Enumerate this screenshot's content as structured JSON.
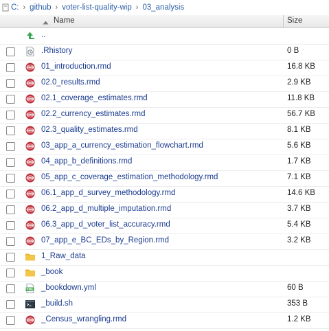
{
  "breadcrumb": {
    "segments": [
      "C:",
      "github",
      "voter-list-quality-wip",
      "03_analysis"
    ],
    "separator": "›"
  },
  "columns": {
    "name": "Name",
    "size": "Size"
  },
  "parent_link": "..",
  "files": [
    {
      "name": ".Rhistory",
      "size": "0 B",
      "icon": "rhistory-icon",
      "checkbox": true
    },
    {
      "name": "01_introduction.rmd",
      "size": "16.8 KB",
      "icon": "rmd-icon",
      "checkbox": true
    },
    {
      "name": "02.0_results.rmd",
      "size": "2.9 KB",
      "icon": "rmd-icon",
      "checkbox": true
    },
    {
      "name": "02.1_coverage_estimates.rmd",
      "size": "11.8 KB",
      "icon": "rmd-icon",
      "checkbox": true
    },
    {
      "name": "02.2_currency_estimates.rmd",
      "size": "56.7 KB",
      "icon": "rmd-icon",
      "checkbox": true
    },
    {
      "name": "02.3_quality_estimates.rmd",
      "size": "8.1 KB",
      "icon": "rmd-icon",
      "checkbox": true
    },
    {
      "name": "03_app_a_currency_estimation_flowchart.rmd",
      "size": "5.6 KB",
      "icon": "rmd-icon",
      "checkbox": true
    },
    {
      "name": "04_app_b_definitions.rmd",
      "size": "1.7 KB",
      "icon": "rmd-icon",
      "checkbox": true
    },
    {
      "name": "05_app_c_coverage_estimation_methodology.rmd",
      "size": "7.1 KB",
      "icon": "rmd-icon",
      "checkbox": true
    },
    {
      "name": "06.1_app_d_survey_methodology.rmd",
      "size": "14.6 KB",
      "icon": "rmd-icon",
      "checkbox": true
    },
    {
      "name": "06.2_app_d_multiple_imputation.rmd",
      "size": "3.7 KB",
      "icon": "rmd-icon",
      "checkbox": true
    },
    {
      "name": "06.3_app_d_voter_list_accuracy.rmd",
      "size": "5.4 KB",
      "icon": "rmd-icon",
      "checkbox": true
    },
    {
      "name": "07_app_e_BC_EDs_by_Region.rmd",
      "size": "3.2 KB",
      "icon": "rmd-icon",
      "checkbox": true
    },
    {
      "name": "1_Raw_data",
      "size": "",
      "icon": "folder-icon",
      "checkbox": true
    },
    {
      "name": "_book",
      "size": "",
      "icon": "folder-icon",
      "checkbox": true
    },
    {
      "name": "_bookdown.yml",
      "size": "60 B",
      "icon": "yml-icon",
      "checkbox": true
    },
    {
      "name": "_build.sh",
      "size": "353 B",
      "icon": "shell-icon",
      "checkbox": true
    },
    {
      "name": "_Census_wrangling.rmd",
      "size": "1.2 KB",
      "icon": "rmd-icon",
      "checkbox": true
    }
  ],
  "colors": {
    "link": "#1a3b8f",
    "breadcrumb": "#2b5ea7",
    "rmd_icon": "#c0303a",
    "folder": "#f3c64a",
    "up_arrow": "#3aa655",
    "yml": "#3fa34d"
  },
  "yml_icon_text": "YML"
}
